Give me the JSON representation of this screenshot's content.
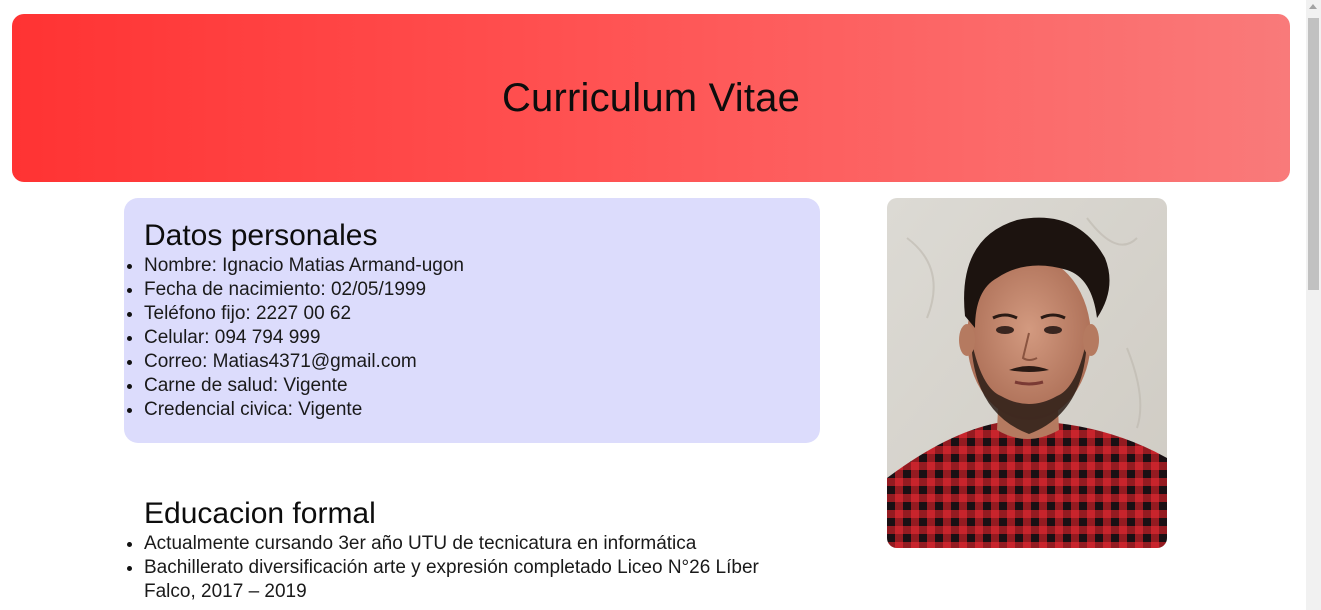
{
  "header": {
    "title": "Curriculum Vitae"
  },
  "personal": {
    "title": "Datos personales",
    "items": [
      "Nombre: Ignacio Matias Armand-ugon",
      "Fecha de nacimiento: 02/05/1999",
      "Teléfono fijo: 2227 00 62",
      "Celular: 094 794 999",
      "Correo: Matias4371@gmail.com",
      "Carne de salud: Vigente",
      "Credencial civica: Vigente"
    ]
  },
  "education": {
    "title": "Educacion formal",
    "items": [
      "Actualmente cursando 3er año UTU de tecnicatura en informática",
      "Bachillerato diversificación arte y expresión completado Liceo N°26 Líber Falco, 2017 – 2019"
    ]
  },
  "colors": {
    "header_gradient_start": "#ff3333",
    "header_gradient_end": "#f97a7a",
    "personal_card_bg": "#dcdcfc"
  },
  "icons": {
    "photo": "profile-photo"
  }
}
